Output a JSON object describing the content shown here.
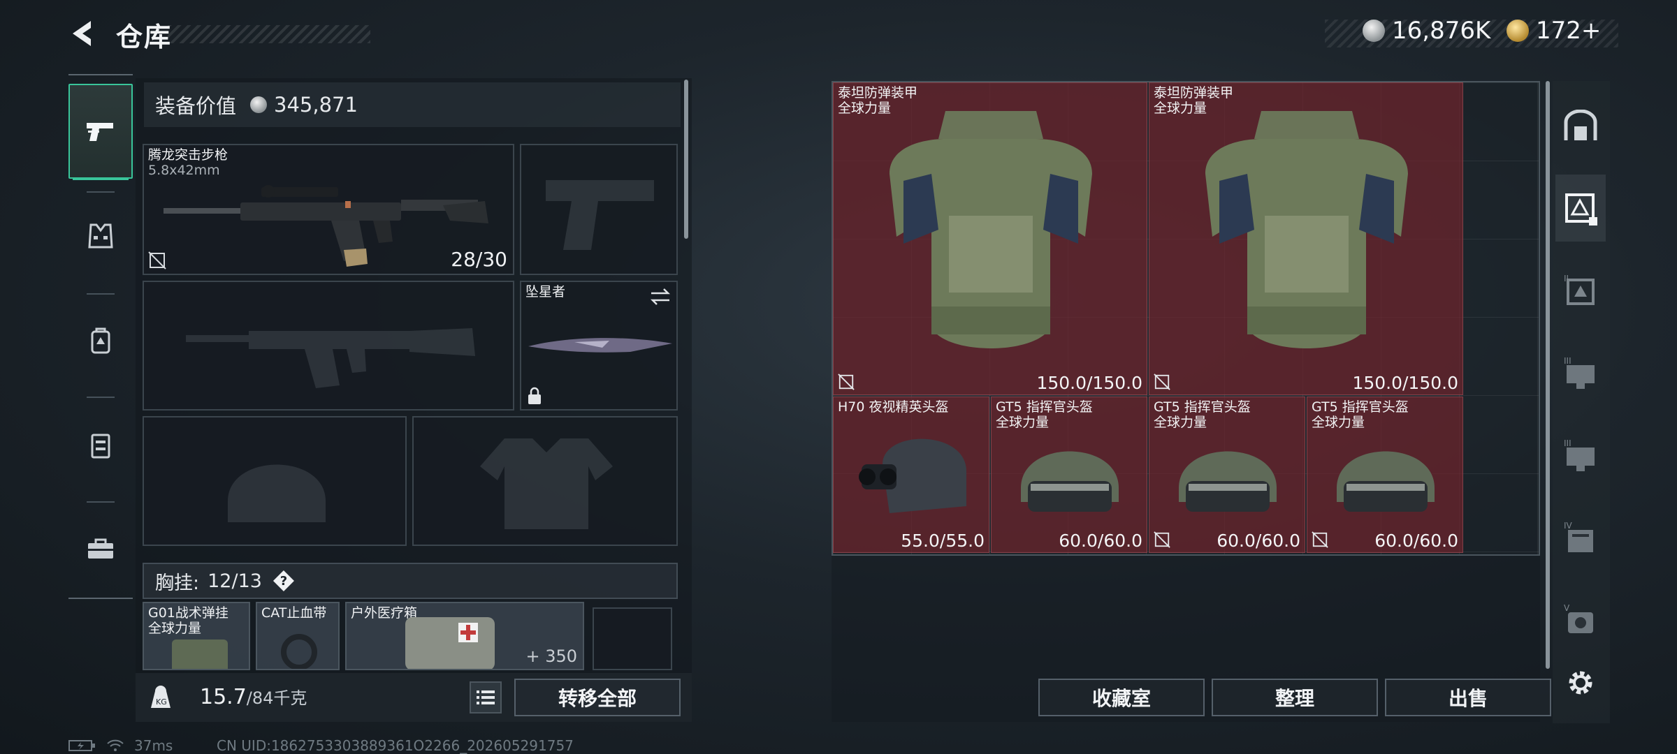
{
  "header": {
    "title": "仓库",
    "back_icon": "back-chevron-icon"
  },
  "currency": {
    "silver": "16,876K",
    "gold": "172+",
    "add_symbol": ""
  },
  "categories": [
    {
      "icon": "pistol-icon",
      "active": true
    },
    {
      "icon": "armor-vest-icon",
      "active": false
    },
    {
      "icon": "backpack-icon",
      "active": false
    },
    {
      "icon": "chest-rig-icon",
      "active": false
    },
    {
      "icon": "toolbox-icon",
      "active": false
    }
  ],
  "loadout": {
    "equip_value_label": "装备价值",
    "equip_value": "345,871",
    "primary_weapon": {
      "name": "腾龙突击步枪",
      "caliber": "5.8x42mm",
      "ammo": "28/30"
    },
    "melee": {
      "name": "坠星者"
    },
    "vest_label": "胸挂:",
    "vest_capacity": "12/13",
    "help": "?",
    "vest_items": [
      {
        "name": "G01战术弹挂",
        "sub": "全球力量"
      },
      {
        "name": "CAT止血带",
        "sub": ""
      },
      {
        "name": "户外医疗箱",
        "sub": ""
      }
    ],
    "vest_extra": "+ 350",
    "weight_current": "15.7",
    "weight_max": "/84千克",
    "transfer_all": "转移全部"
  },
  "storage": {
    "items": [
      {
        "name": "泰坦防弹装甲",
        "sub": "全球力量",
        "durability": "150.0/150.0",
        "type": "armor"
      },
      {
        "name": "泰坦防弹装甲",
        "sub": "全球力量",
        "durability": "150.0/150.0",
        "type": "armor"
      },
      {
        "name": "H70 夜视精英头盔",
        "sub": "",
        "durability": "55.0/55.0",
        "type": "nv-helmet"
      },
      {
        "name": "GT5 指挥官头盔",
        "sub": "全球力量",
        "durability": "60.0/60.0",
        "type": "helmet"
      },
      {
        "name": "GT5 指挥官头盔",
        "sub": "全球力量",
        "durability": "60.0/60.0",
        "type": "helmet"
      },
      {
        "name": "GT5 指挥官头盔",
        "sub": "全球力量",
        "durability": "60.0/60.0",
        "type": "helmet"
      }
    ],
    "tabs": [
      {
        "icon": "storage-room-icon",
        "label": ""
      },
      {
        "icon": "warehouse-tab-1-icon",
        "label": ""
      },
      {
        "icon": "warehouse-tab-2-icon",
        "label": "II"
      },
      {
        "icon": "warehouse-tab-3-icon",
        "label": "III"
      },
      {
        "icon": "warehouse-tab-4-icon",
        "label": "III"
      },
      {
        "icon": "warehouse-tab-5-icon",
        "label": "IV"
      },
      {
        "icon": "warehouse-tab-6-icon",
        "label": "V"
      }
    ],
    "buttons": {
      "collection": "收藏室",
      "organize": "整理",
      "sell": "出售"
    }
  },
  "status": {
    "ping": "37ms",
    "uid": "CN UID:1862753303889361O2266_202605291757"
  },
  "colors": {
    "accent": "#39c59a",
    "item_bg": "#6e242c",
    "panel_border": "#4a555d"
  }
}
